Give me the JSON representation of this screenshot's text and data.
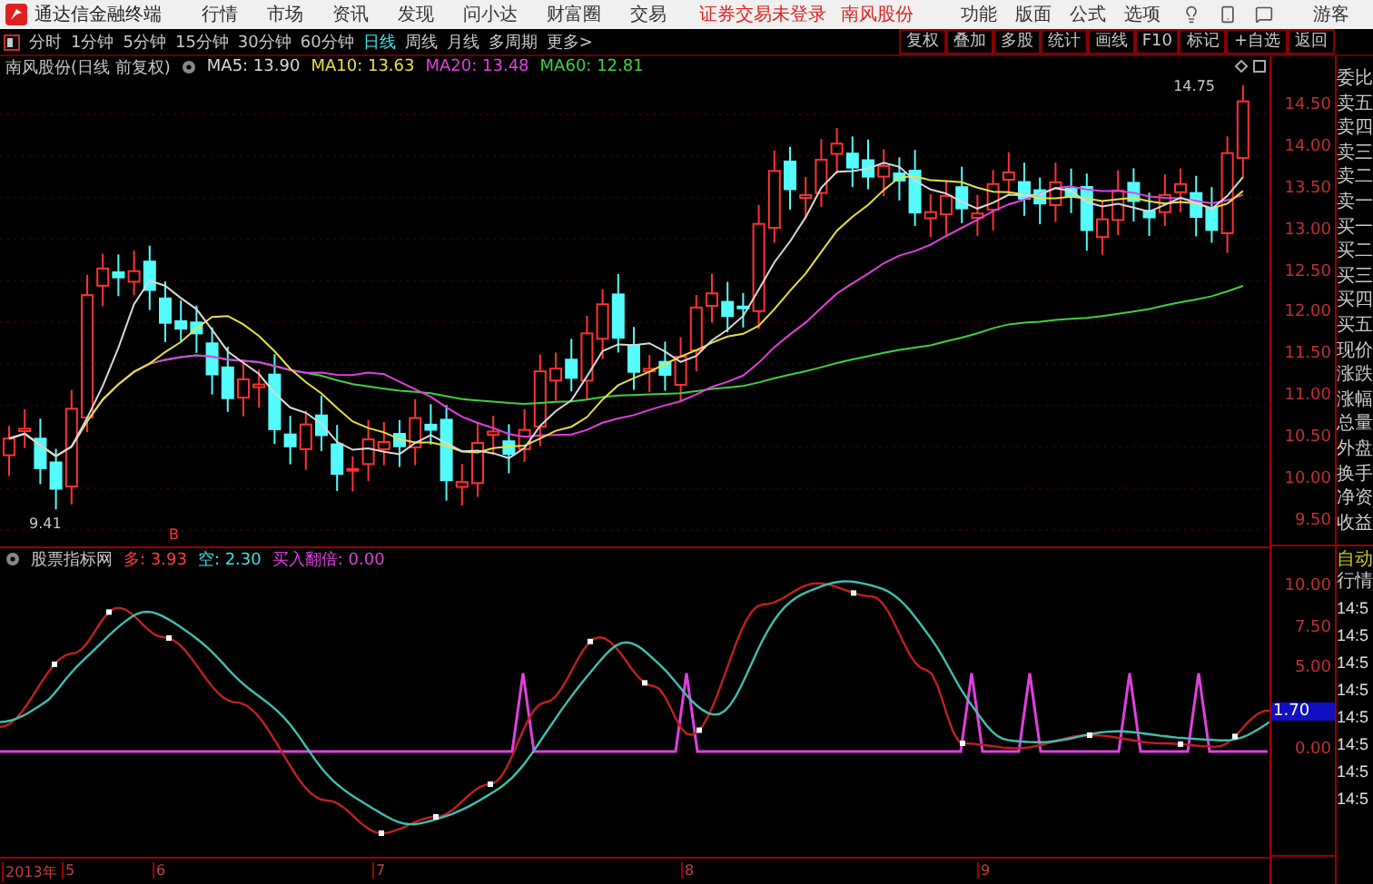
{
  "app": {
    "title": "通达信金融终端"
  },
  "menu": [
    "行情",
    "市场",
    "资讯",
    "发现",
    "问小达",
    "财富圈",
    "交易"
  ],
  "notice": "证券交易未登录",
  "stock_link": "南风股份",
  "right_menu": [
    "功能",
    "版面",
    "公式",
    "选项"
  ],
  "user": "游客",
  "periods": [
    {
      "label": "分时",
      "selected": false
    },
    {
      "label": "1分钟",
      "selected": false
    },
    {
      "label": "5分钟",
      "selected": false
    },
    {
      "label": "15分钟",
      "selected": false
    },
    {
      "label": "30分钟",
      "selected": false
    },
    {
      "label": "60分钟",
      "selected": false
    },
    {
      "label": "日线",
      "selected": true
    },
    {
      "label": "周线",
      "selected": false
    },
    {
      "label": "月线",
      "selected": false
    },
    {
      "label": "多周期",
      "selected": false
    },
    {
      "label": "更多>",
      "selected": false
    }
  ],
  "tools": [
    "复权",
    "叠加",
    "多股",
    "统计",
    "画线",
    "F10",
    "标记",
    "+自选",
    "返回"
  ],
  "chart": {
    "title": "南风股份(日线 前复权)",
    "ma": [
      {
        "text": "MA5: 13.90",
        "color": "#d8d8d8"
      },
      {
        "text": "MA10: 13.63",
        "color": "#e6e040"
      },
      {
        "text": "MA20: 13.48",
        "color": "#e040e0"
      },
      {
        "text": "MA60: 12.81",
        "color": "#40d040"
      }
    ],
    "high_label": "14.75",
    "low_label": "9.41",
    "marker": "B",
    "price_ticks": [
      "14.50",
      "14.00",
      "13.50",
      "13.00",
      "12.50",
      "12.00",
      "11.50",
      "11.00",
      "10.50",
      "10.00",
      "9.50"
    ]
  },
  "indicator": {
    "title": "股票指标网",
    "legend": [
      {
        "text": "多: 3.93",
        "color": "#ff3c3c"
      },
      {
        "text": "空: 2.30",
        "color": "#40e0e0"
      },
      {
        "text": "买入翻倍: 0.00",
        "color": "#e040e0"
      }
    ],
    "ticks": [
      "10.00",
      "7.50",
      "5.00",
      "0.00"
    ],
    "current": "1.70"
  },
  "dates": [
    "2013年",
    "5",
    "6",
    "7",
    "8",
    "9"
  ],
  "side_panel": {
    "quote_labels": [
      "委比",
      "卖五",
      "卖四",
      "卖三",
      "卖二",
      "卖一",
      "买一",
      "买二",
      "买三",
      "买四",
      "买五",
      "现价",
      "涨跌",
      "涨幅",
      "总量",
      "外盘",
      "换手",
      "净资",
      "收益"
    ],
    "auto": "自动",
    "ticks_title": "行情",
    "times": [
      "14:5",
      "14:5",
      "14:5",
      "14:5",
      "14:5",
      "14:5",
      "14:5",
      "14:5"
    ]
  }
}
